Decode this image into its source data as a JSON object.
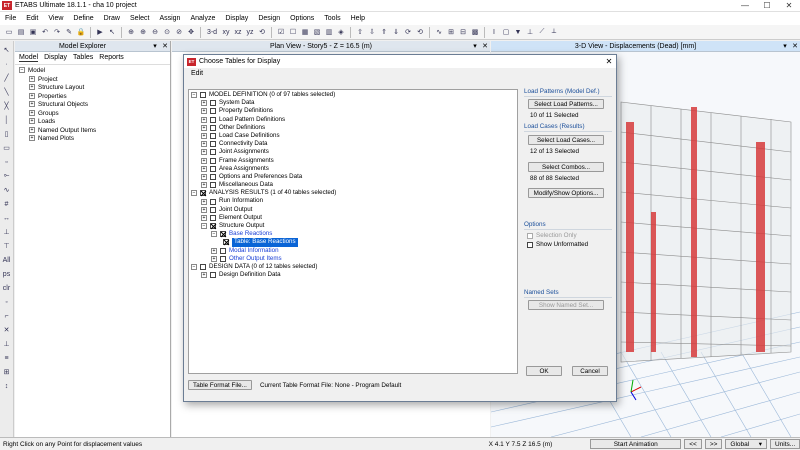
{
  "titlebar": {
    "logo": "ET",
    "title": "ETABS Ultimate 18.1.1 - cha 10 project",
    "minimize": "—",
    "maximize": "☐",
    "close": "✕"
  },
  "menubar": [
    "File",
    "Edit",
    "View",
    "Define",
    "Draw",
    "Select",
    "Assign",
    "Analyze",
    "Display",
    "Design",
    "Options",
    "Tools",
    "Help"
  ],
  "explorer": {
    "title": "Model Explorer",
    "tabs": [
      "Model",
      "Display",
      "Tables",
      "Reports"
    ],
    "root": "Model",
    "items": [
      "Project",
      "Structure Layout",
      "Properties",
      "Structural Objects",
      "Groups",
      "Loads",
      "Named Output Items",
      "Named Plots"
    ]
  },
  "planview": {
    "title": "Plan View - Story5 - Z = 16.5 (m)"
  },
  "view3d": {
    "title": "3-D View  - Displacements (Dead)  [mm]"
  },
  "dialog": {
    "logo": "ET",
    "title": "Choose Tables for Display",
    "menu": "Edit",
    "tree": {
      "model_definition": "MODEL DEFINITION  (0 of 97 tables selected)",
      "md_items": [
        "System Data",
        "Property Definitions",
        "Load Pattern Definitions",
        "Other Definitions",
        "Load Case Definitions",
        "Connectivity Data",
        "Joint Assignments",
        "Frame Assignments",
        "Area Assignments",
        "Options and Preferences Data",
        "Miscellaneous Data"
      ],
      "analysis_results": "ANALYSIS RESULTS  (1 of 40 tables selected)",
      "ar_items": [
        "Run Information",
        "Joint Output",
        "Element Output",
        "Structure Output"
      ],
      "base_reactions": "Base Reactions",
      "table_base_reactions": "Table:  Base Reactions",
      "modal_information": "Modal Information",
      "other_output_items": "Other Output Items",
      "design_data": "DESIGN DATA  (0 of 12 tables selected)",
      "dd_items": [
        "Design Definition Data"
      ]
    },
    "load_patterns": {
      "label": "Load Patterns (Model Def.)",
      "button": "Select Load Patterns...",
      "status": "10 of 11 Selected"
    },
    "load_cases": {
      "label": "Load Cases (Results)",
      "button": "Select Load Cases...",
      "status": "12 of 13 Selected",
      "combos_button": "Select Combos...",
      "combos_status": "88 of 88 Selected",
      "modify_button": "Modify/Show Options..."
    },
    "options": {
      "label": "Options",
      "selection_only": "Selection Only",
      "show_unformatted": "Show Unformatted"
    },
    "named_sets": {
      "label": "Named Sets",
      "button": "Show Named Set..."
    },
    "table_format_button": "Table Format File...",
    "current_format": "Current Table Format File:  None - Program Default",
    "ok": "OK",
    "cancel": "Cancel"
  },
  "statusbar": {
    "hint": "Right Click on any Point for displacement values",
    "coords": "X 4.1  Y 7.5  Z 16.5 (m)",
    "animation": "Start Animation",
    "prev": "<<",
    "next": ">>",
    "coord_system": "Global",
    "units": "Units..."
  }
}
